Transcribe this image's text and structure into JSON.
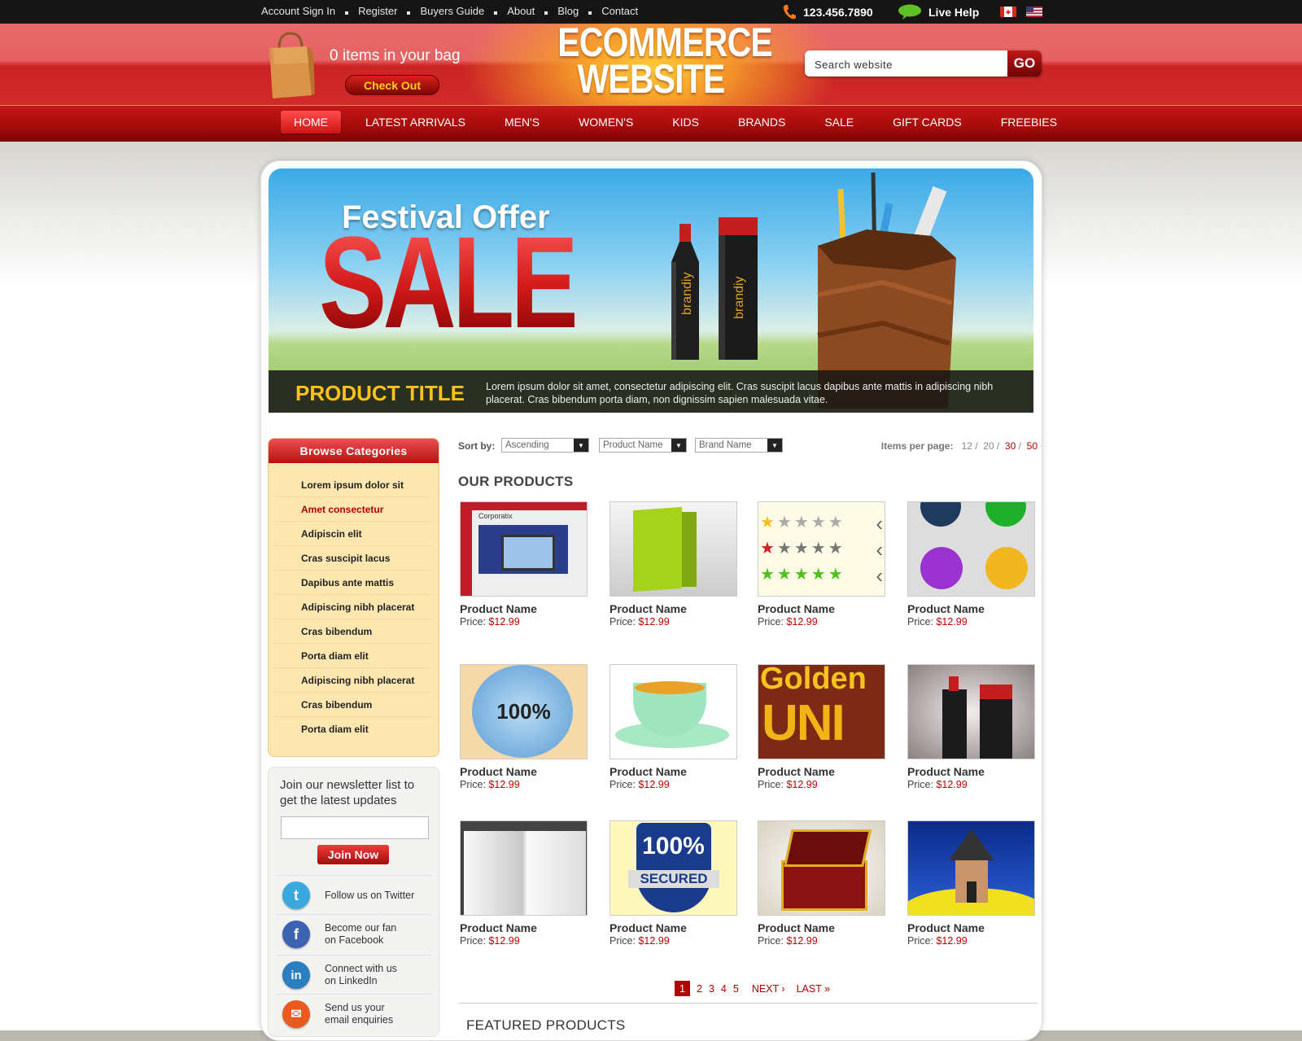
{
  "topbar": {
    "links": [
      "Account Sign In",
      "Register",
      "Buyers Guide",
      "About",
      "Blog",
      "Contact"
    ],
    "phone": "123.456.7890",
    "live_help": "Live Help"
  },
  "header": {
    "bag_text": "0 items in your bag",
    "checkout_label": "Check Out",
    "logo_line1": "ECOMMERCE",
    "logo_line2": "WEBSITE",
    "search_placeholder": "Search website",
    "go_label": "GO"
  },
  "nav": {
    "items": [
      "HOME",
      "LATEST ARRIVALS",
      "MEN'S",
      "WOMEN'S",
      "KIDS",
      "BRANDS",
      "SALE",
      "GIFT CARDS",
      "FREEBIES"
    ],
    "active": "HOME"
  },
  "banner": {
    "festival": "Festival Offer",
    "sale": "SALE",
    "brand_text": "brandiy",
    "product_title": "PRODUCT TITLE",
    "description": "Lorem ipsum dolor sit amet, consectetur adipiscing elit. Cras suscipit lacus dapibus ante mattis in adipiscing nibh placerat. Cras bibendum porta diam, non dignissim sapien malesuada vitae."
  },
  "sidebar": {
    "categories_title": "Browse Categories",
    "categories": [
      "Lorem ipsum dolor sit",
      "Amet consectetur",
      "Adipiscin elit",
      "Cras suscipit lacus",
      "Dapibus ante mattis",
      "Adipiscing nibh placerat",
      "Cras bibendum",
      "Porta diam elit",
      "Adipiscing nibh placerat",
      "Cras bibendum",
      "Porta diam elit"
    ],
    "active_category": "Amet consectetur",
    "newsletter_text": "Join our newsletter list to get the latest updates",
    "join_label": "Join Now",
    "social": [
      {
        "icon": "twitter-icon",
        "text": "Follow us on Twitter",
        "color": "#3ba9e0"
      },
      {
        "icon": "facebook-icon",
        "text": "Become our fan\non Facebook",
        "color": "#3b63b2"
      },
      {
        "icon": "linkedin-icon",
        "text": "Connect with us\non LinkedIn",
        "color": "#2a7fc1"
      },
      {
        "icon": "email-icon",
        "text": "Send us your\nemail enquiries",
        "color": "#e85a1e"
      }
    ]
  },
  "sortbar": {
    "sort_label": "Sort by:",
    "sort_order": "Ascending",
    "sort_field": "Product Name",
    "sort_brand": "Brand Name",
    "ipp_label": "Items per page:",
    "ipp_options": [
      "12",
      "20",
      "30",
      "50"
    ],
    "ipp_separator": "/"
  },
  "products": {
    "heading": "OUR PRODUCTS",
    "price_label": "Price:",
    "items": [
      {
        "name": "Product Name",
        "price": "$12.99",
        "thumb": "website-screens",
        "thumb_text": "Corporatix"
      },
      {
        "name": "Product Name",
        "price": "$12.99",
        "thumb": "green-bag",
        "thumb_text": ""
      },
      {
        "name": "Product Name",
        "price": "$12.99",
        "thumb": "star-ratings",
        "thumb_text": ""
      },
      {
        "name": "Product Name",
        "price": "$12.99",
        "thumb": "social-buttons",
        "thumb_text": ""
      },
      {
        "name": "Product Name",
        "price": "$12.99",
        "thumb": "satisfaction-seal",
        "thumb_text": "100%"
      },
      {
        "name": "Product Name",
        "price": "$12.99",
        "thumb": "tea-cup",
        "thumb_text": ""
      },
      {
        "name": "Product Name",
        "price": "$12.99",
        "thumb": "golden-text",
        "thumb_text": "Golden"
      },
      {
        "name": "Product Name",
        "price": "$12.99",
        "thumb": "bottles",
        "thumb_text": ""
      },
      {
        "name": "Product Name",
        "price": "$12.99",
        "thumb": "open-book",
        "thumb_text": ""
      },
      {
        "name": "Product Name",
        "price": "$12.99",
        "thumb": "secured-shield",
        "thumb_text": "100%"
      },
      {
        "name": "Product Name",
        "price": "$12.99",
        "thumb": "treasure-chest",
        "thumb_text": ""
      },
      {
        "name": "Product Name",
        "price": "$12.99",
        "thumb": "hut",
        "thumb_text": ""
      }
    ]
  },
  "pager": {
    "pages": [
      "1",
      "2",
      "3",
      "4",
      "5"
    ],
    "current": "1",
    "next": "NEXT",
    "last": "LAST"
  },
  "featured_heading": "FEATURED PRODUCTS",
  "colors": {
    "accent_red": "#c81717",
    "price_red": "#c00000",
    "title_gold": "#ffc21b",
    "category_bg": "#fde7b0"
  }
}
